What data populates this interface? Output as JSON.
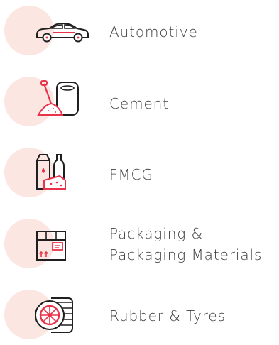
{
  "theme": {
    "blob_color": "#fbe6e1",
    "icon_stroke": "#1f1f1f",
    "icon_accent": "#e8334a",
    "text_color": "#404040"
  },
  "industries": [
    {
      "id": "automotive",
      "icon": "car-icon",
      "label": "Automotive"
    },
    {
      "id": "cement",
      "icon": "cement-bag-shovel-icon",
      "label": "Cement"
    },
    {
      "id": "fmcg",
      "icon": "grocery-products-icon",
      "label": "FMCG"
    },
    {
      "id": "packaging",
      "icon": "cardboard-box-icon",
      "label_line1": "Packaging &",
      "label_line2": "Packaging Materials"
    },
    {
      "id": "rubber",
      "icon": "tyre-stack-icon",
      "label": "Rubber & Tyres"
    }
  ]
}
